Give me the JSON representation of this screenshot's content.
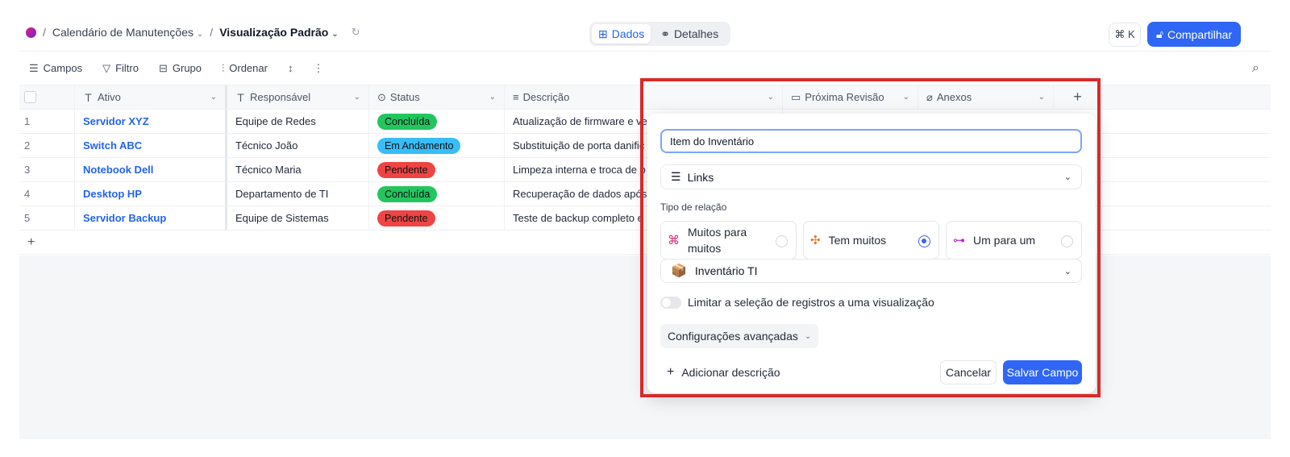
{
  "breadcrumb": {
    "separator": "/",
    "table": "Calendário de Manutenções",
    "view": "Visualização Padrão"
  },
  "view_toggle": {
    "data": "Dados",
    "details": "Detalhes"
  },
  "header_actions": {
    "cmdk": "⌘ K",
    "share": "Compartilhar"
  },
  "toolbar": {
    "fields": "Campos",
    "filter": "Filtro",
    "group": "Grupo",
    "sort": "Ordenar"
  },
  "columns": {
    "asset": "Ativo",
    "responsible": "Responsável",
    "status": "Status",
    "description": "Descrição",
    "next_review": "Próxima Revisão",
    "attachments": "Anexos",
    "add": "+"
  },
  "rows": [
    {
      "num": "1",
      "asset": "Servidor XYZ",
      "responsible": "Equipe de Redes",
      "status": "Concluída",
      "status_color": "#22c55e",
      "description": "Atualização de firmware e ve"
    },
    {
      "num": "2",
      "asset": "Switch ABC",
      "responsible": "Técnico João",
      "status": "Em Andamento",
      "status_color": "#38bdf8",
      "description": "Substituição de porta danific"
    },
    {
      "num": "3",
      "asset": "Notebook Dell",
      "responsible": "Técnico Maria",
      "status": "Pendente",
      "status_color": "#ef4444",
      "description": "Limpeza interna e troca de p"
    },
    {
      "num": "4",
      "asset": "Desktop HP",
      "responsible": "Departamento de TI",
      "status": "Concluída",
      "status_color": "#22c55e",
      "description": "Recuperação de dados após"
    },
    {
      "num": "5",
      "asset": "Servidor Backup",
      "responsible": "Equipe de Sistemas",
      "status": "Pendente",
      "status_color": "#ef4444",
      "description": "Teste de backup completo e"
    }
  ],
  "add_row": "+",
  "field_modal": {
    "name_value": "Item do Inventário",
    "field_type": "Links",
    "relation_label": "Tipo de relação",
    "relation_options": [
      {
        "label": "Muitos para muitos",
        "selected": false
      },
      {
        "label": "Tem muitos",
        "selected": true
      },
      {
        "label": "Um para um",
        "selected": false
      }
    ],
    "linked_table": "Inventário TI",
    "limit_toggle_label": "Limitar a seleção de registros a uma visualização",
    "advanced_label": "Configurações avançadas",
    "add_description": "Adicionar descrição",
    "cancel": "Cancelar",
    "save": "Salvar Campo"
  },
  "colors": {
    "accent": "#2f66f6",
    "highlight_border": "#d82a2a"
  }
}
